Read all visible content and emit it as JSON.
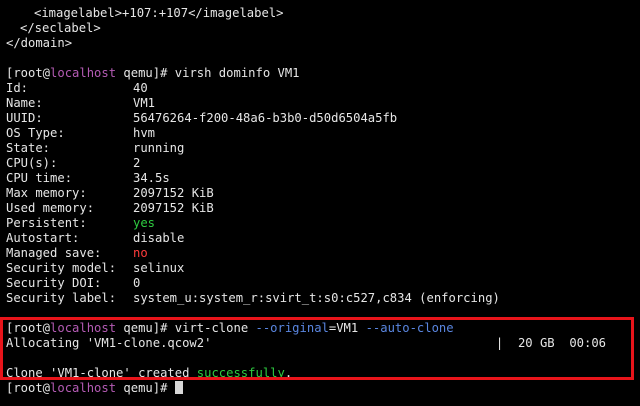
{
  "colors": {
    "background": "#000000",
    "text": "#e6e6e6",
    "hostname": "#b45bb4",
    "success_green": "#2ecc40",
    "error_red": "#ff3b3b",
    "option_blue": "#5a86e0",
    "highlight_border": "#e8141a"
  },
  "xml_tail": {
    "imagelabel_line": "<imagelabel>+107:+107</imagelabel>",
    "seclabel_close": "</seclabel>",
    "domain_close": "</domain>"
  },
  "prompt": {
    "open": "[root@",
    "host": "localhost",
    "close": " qemu]# "
  },
  "dominfo": {
    "command": "virsh dominfo VM1",
    "rows": [
      {
        "key": "Id:",
        "value": "40"
      },
      {
        "key": "Name:",
        "value": "VM1"
      },
      {
        "key": "UUID:",
        "value": "56476264-f200-48a6-b3b0-d50d6504a5fb"
      },
      {
        "key": "OS Type:",
        "value": "hvm"
      },
      {
        "key": "State:",
        "value": "running"
      },
      {
        "key": "CPU(s):",
        "value": "2"
      },
      {
        "key": "CPU time:",
        "value": "34.5s"
      },
      {
        "key": "Max memory:",
        "value": "2097152 KiB"
      },
      {
        "key": "Used memory:",
        "value": "2097152 KiB"
      },
      {
        "key": "Persistent:",
        "value": "yes"
      },
      {
        "key": "Autostart:",
        "value": "disable"
      },
      {
        "key": "Managed save:",
        "value": "no"
      },
      {
        "key": "Security model:",
        "value": "selinux"
      },
      {
        "key": "Security DOI:",
        "value": "0"
      },
      {
        "key": "Security label:",
        "value": "system_u:system_r:svirt_t:s0:c527,c834 (enforcing)"
      }
    ]
  },
  "clone": {
    "cmd_name": "virt-clone ",
    "opt_original": "--original",
    "original_value": "=VM1 ",
    "opt_auto": "--auto-clone",
    "allocating": "Allocating 'VM1-clone.qcow2'",
    "progress_sep": "|",
    "progress_size": "20 GB",
    "progress_time": "00:06",
    "result_prefix": "Clone 'VM1-clone' created ",
    "result_word": "successfully",
    "result_suffix": "."
  }
}
